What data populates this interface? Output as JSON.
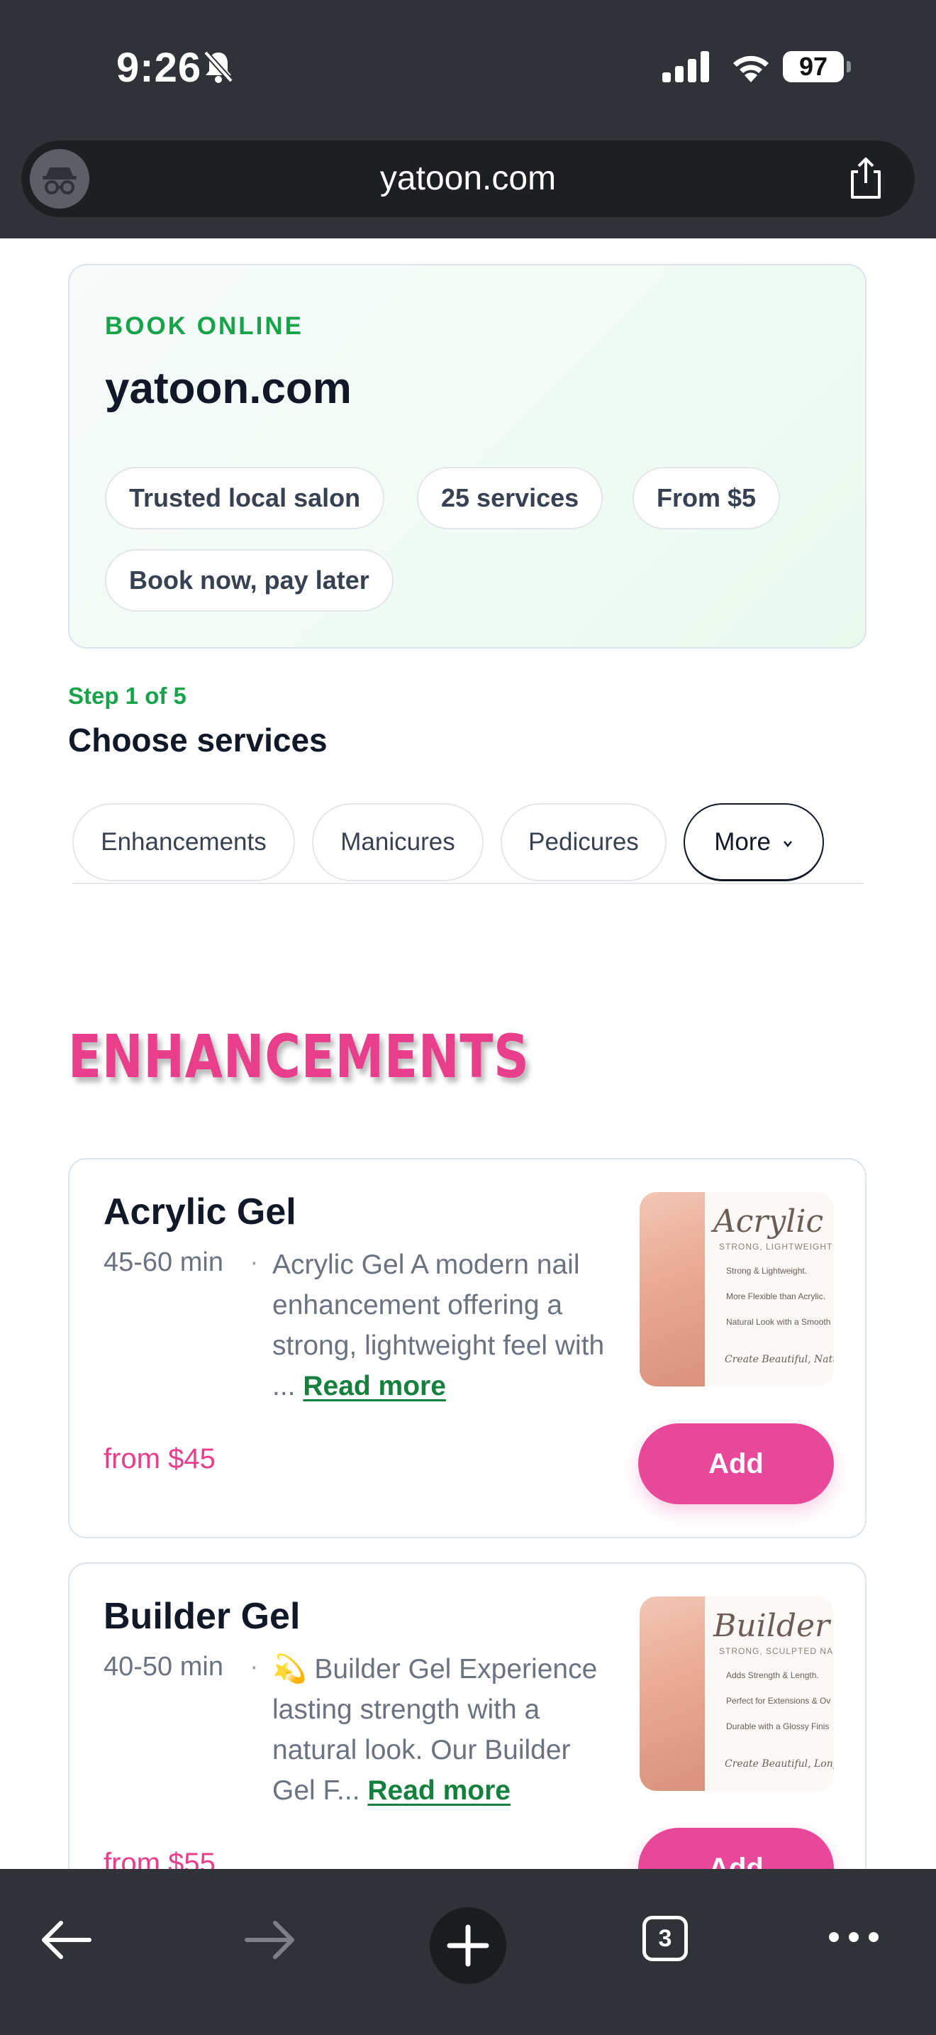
{
  "status": {
    "time": "9:26",
    "battery": "97"
  },
  "browser": {
    "url": "yatoon.com",
    "tab_count": "3"
  },
  "hero": {
    "eyebrow": "BOOK ONLINE",
    "title": "yatoon.com",
    "chips": [
      "Trusted local salon",
      "25 services",
      "From $5",
      "Book now, pay later"
    ]
  },
  "step": {
    "label": "Step 1 of 5",
    "title": "Choose services"
  },
  "tabs": [
    {
      "label": "Enhancements"
    },
    {
      "label": "Manicures"
    },
    {
      "label": "Pedicures"
    },
    {
      "label": "More"
    }
  ],
  "section": {
    "title": "ENHANCEMENTS"
  },
  "services": [
    {
      "name": "Acrylic Gel",
      "duration": "45-60 min",
      "description": "Acrylic Gel A modern nail enhancement offering a strong, lightweight feel with ...",
      "read_more": "Read more",
      "price": "from $45",
      "add_label": "Add",
      "image": {
        "title": "Acrylic Ge",
        "subtitle": "STRONG, LIGHTWEIGHT ENHANCEM",
        "lines": [
          "Strong & Lightweight.",
          "More Flexible than Acrylic.",
          "Natural Look with a Smooth"
        ],
        "footer": "Create Beautiful, Natural"
      }
    },
    {
      "name": "Builder Gel",
      "duration": "40-50 min",
      "description": "💫 Builder Gel Experience lasting strength with a natural look. Our Builder Gel F...",
      "read_more": "Read more",
      "price": "from $55",
      "add_label": "Add",
      "image": {
        "title": "Builder Ge",
        "subtitle": "STRONG, SCULPTED NAILS",
        "lines": [
          "Adds Strength & Length.",
          "Perfect for Extensions & Ov",
          "Durable with a Glossy Finis"
        ],
        "footer": "Create Beautiful, Long-Lasting"
      }
    }
  ],
  "colors": {
    "accent_green": "#16a34a",
    "accent_pink": "#e9479a",
    "price_pink": "#e83e8c",
    "chrome": "#2f3237"
  }
}
